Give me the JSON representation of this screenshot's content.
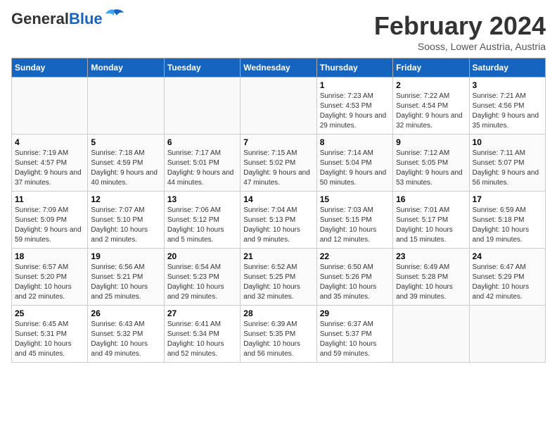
{
  "header": {
    "logo_main": "General",
    "logo_blue": "Blue",
    "title": "February 2024",
    "subtitle": "Sooss, Lower Austria, Austria"
  },
  "days_of_week": [
    "Sunday",
    "Monday",
    "Tuesday",
    "Wednesday",
    "Thursday",
    "Friday",
    "Saturday"
  ],
  "weeks": [
    [
      {
        "day": "",
        "info": ""
      },
      {
        "day": "",
        "info": ""
      },
      {
        "day": "",
        "info": ""
      },
      {
        "day": "",
        "info": ""
      },
      {
        "day": "1",
        "info": "Sunrise: 7:23 AM\nSunset: 4:53 PM\nDaylight: 9 hours and 29 minutes."
      },
      {
        "day": "2",
        "info": "Sunrise: 7:22 AM\nSunset: 4:54 PM\nDaylight: 9 hours and 32 minutes."
      },
      {
        "day": "3",
        "info": "Sunrise: 7:21 AM\nSunset: 4:56 PM\nDaylight: 9 hours and 35 minutes."
      }
    ],
    [
      {
        "day": "4",
        "info": "Sunrise: 7:19 AM\nSunset: 4:57 PM\nDaylight: 9 hours and 37 minutes."
      },
      {
        "day": "5",
        "info": "Sunrise: 7:18 AM\nSunset: 4:59 PM\nDaylight: 9 hours and 40 minutes."
      },
      {
        "day": "6",
        "info": "Sunrise: 7:17 AM\nSunset: 5:01 PM\nDaylight: 9 hours and 44 minutes."
      },
      {
        "day": "7",
        "info": "Sunrise: 7:15 AM\nSunset: 5:02 PM\nDaylight: 9 hours and 47 minutes."
      },
      {
        "day": "8",
        "info": "Sunrise: 7:14 AM\nSunset: 5:04 PM\nDaylight: 9 hours and 50 minutes."
      },
      {
        "day": "9",
        "info": "Sunrise: 7:12 AM\nSunset: 5:05 PM\nDaylight: 9 hours and 53 minutes."
      },
      {
        "day": "10",
        "info": "Sunrise: 7:11 AM\nSunset: 5:07 PM\nDaylight: 9 hours and 56 minutes."
      }
    ],
    [
      {
        "day": "11",
        "info": "Sunrise: 7:09 AM\nSunset: 5:09 PM\nDaylight: 9 hours and 59 minutes."
      },
      {
        "day": "12",
        "info": "Sunrise: 7:07 AM\nSunset: 5:10 PM\nDaylight: 10 hours and 2 minutes."
      },
      {
        "day": "13",
        "info": "Sunrise: 7:06 AM\nSunset: 5:12 PM\nDaylight: 10 hours and 5 minutes."
      },
      {
        "day": "14",
        "info": "Sunrise: 7:04 AM\nSunset: 5:13 PM\nDaylight: 10 hours and 9 minutes."
      },
      {
        "day": "15",
        "info": "Sunrise: 7:03 AM\nSunset: 5:15 PM\nDaylight: 10 hours and 12 minutes."
      },
      {
        "day": "16",
        "info": "Sunrise: 7:01 AM\nSunset: 5:17 PM\nDaylight: 10 hours and 15 minutes."
      },
      {
        "day": "17",
        "info": "Sunrise: 6:59 AM\nSunset: 5:18 PM\nDaylight: 10 hours and 19 minutes."
      }
    ],
    [
      {
        "day": "18",
        "info": "Sunrise: 6:57 AM\nSunset: 5:20 PM\nDaylight: 10 hours and 22 minutes."
      },
      {
        "day": "19",
        "info": "Sunrise: 6:56 AM\nSunset: 5:21 PM\nDaylight: 10 hours and 25 minutes."
      },
      {
        "day": "20",
        "info": "Sunrise: 6:54 AM\nSunset: 5:23 PM\nDaylight: 10 hours and 29 minutes."
      },
      {
        "day": "21",
        "info": "Sunrise: 6:52 AM\nSunset: 5:25 PM\nDaylight: 10 hours and 32 minutes."
      },
      {
        "day": "22",
        "info": "Sunrise: 6:50 AM\nSunset: 5:26 PM\nDaylight: 10 hours and 35 minutes."
      },
      {
        "day": "23",
        "info": "Sunrise: 6:49 AM\nSunset: 5:28 PM\nDaylight: 10 hours and 39 minutes."
      },
      {
        "day": "24",
        "info": "Sunrise: 6:47 AM\nSunset: 5:29 PM\nDaylight: 10 hours and 42 minutes."
      }
    ],
    [
      {
        "day": "25",
        "info": "Sunrise: 6:45 AM\nSunset: 5:31 PM\nDaylight: 10 hours and 45 minutes."
      },
      {
        "day": "26",
        "info": "Sunrise: 6:43 AM\nSunset: 5:32 PM\nDaylight: 10 hours and 49 minutes."
      },
      {
        "day": "27",
        "info": "Sunrise: 6:41 AM\nSunset: 5:34 PM\nDaylight: 10 hours and 52 minutes."
      },
      {
        "day": "28",
        "info": "Sunrise: 6:39 AM\nSunset: 5:35 PM\nDaylight: 10 hours and 56 minutes."
      },
      {
        "day": "29",
        "info": "Sunrise: 6:37 AM\nSunset: 5:37 PM\nDaylight: 10 hours and 59 minutes."
      },
      {
        "day": "",
        "info": ""
      },
      {
        "day": "",
        "info": ""
      }
    ]
  ]
}
